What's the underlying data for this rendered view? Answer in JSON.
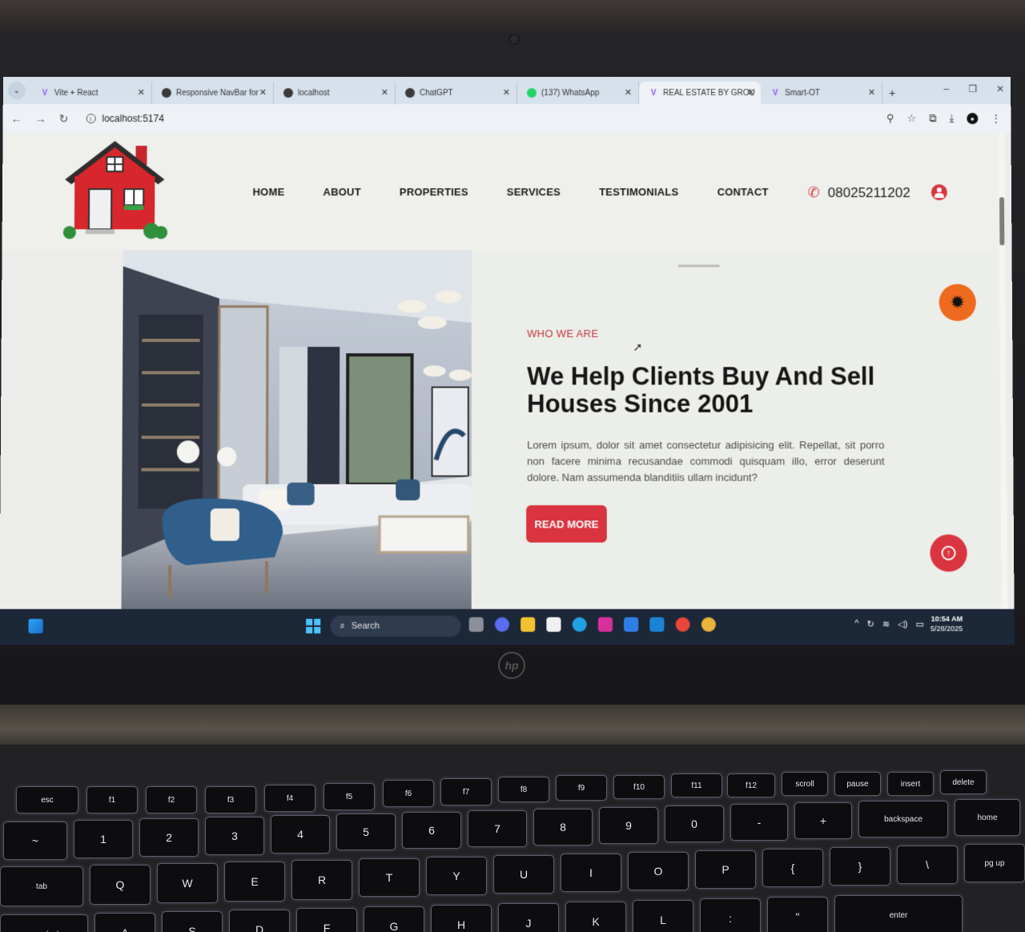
{
  "browser": {
    "tabs": [
      {
        "title": "Vite + React",
        "icon": "vite-icon",
        "active": false
      },
      {
        "title": "Responsive NavBar for",
        "icon": "globe-icon",
        "active": false
      },
      {
        "title": "localhost",
        "icon": "globe-icon",
        "active": false
      },
      {
        "title": "ChatGPT",
        "icon": "chatgpt-icon",
        "active": false
      },
      {
        "title": "(137) WhatsApp",
        "icon": "whatsapp-icon",
        "active": false
      },
      {
        "title": "REAL ESTATE BY GROU",
        "icon": "vite-icon",
        "active": true
      },
      {
        "title": "Smart-OT",
        "icon": "vite-icon",
        "active": false
      }
    ],
    "new_tab": "+",
    "url": "localhost:5174"
  },
  "site": {
    "nav": {
      "home": "HOME",
      "about": "ABOUT",
      "properties": "PROPERTIES",
      "services": "SERVICES",
      "testimonials": "TESTIMONIALS",
      "contact": "CONTACT"
    },
    "phone": "08025211202",
    "hero": {
      "eyebrow": "WHO WE ARE",
      "headline": "We Help Clients Buy And Sell Houses Since 2001",
      "body": "Lorem ipsum, dolor sit amet consectetur adipisicing elit. Repellat, sit porro non facere minima recusandae commodi quisquam illo, error deserunt dolore. Nam assumenda blanditiis ullam incidunt?",
      "cta": "READ MORE"
    },
    "colors": {
      "accent": "#d9343f",
      "theme_toggle": "#ee6a1e"
    }
  },
  "taskbar": {
    "search_label": "Search",
    "time": "10:54 AM",
    "date": "5/28/2025"
  },
  "laptop": {
    "brand": "hp"
  },
  "keyboard": {
    "row_fn": [
      "esc",
      "f1",
      "f2",
      "f3",
      "f4",
      "f5",
      "f6",
      "f7",
      "f8",
      "f9",
      "f10",
      "f11",
      "f12",
      "scroll",
      "pause",
      "insert",
      "delete"
    ],
    "row_num": [
      "~",
      "1",
      "2",
      "3",
      "4",
      "5",
      "6",
      "7",
      "8",
      "9",
      "0",
      "-",
      "+",
      "backspace",
      "home"
    ],
    "row_q": [
      "tab",
      "Q",
      "W",
      "E",
      "R",
      "T",
      "Y",
      "U",
      "I",
      "O",
      "P",
      "{",
      "}",
      "\\",
      "pg up"
    ],
    "row_a": [
      "caps lock",
      "A",
      "S",
      "D",
      "F",
      "G",
      "H",
      "J",
      "K",
      "L",
      ":",
      "\"",
      "enter"
    ]
  }
}
